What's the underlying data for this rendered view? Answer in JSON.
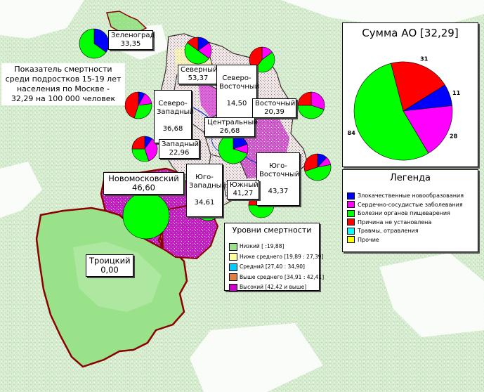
{
  "caption": [
    "Показатель смертности",
    "среди подростков 15-19 лет",
    "населения по Москве -",
    "32,29 на 100 000 человек"
  ],
  "colors": {
    "greenery": "#dcefd6",
    "forest": "#c3e0bb",
    "territory": "#99e28a",
    "high_level": "#cc00cc",
    "mid_high": "#e08040",
    "boundary": "#8b0000"
  },
  "summary": {
    "title": "Сумма АО [32,29]",
    "slices": [
      {
        "label": "11",
        "value": 11,
        "color": "#0000ff"
      },
      {
        "label": "28",
        "value": 28,
        "color": "#ff00ff"
      },
      {
        "label": "84",
        "value": 84,
        "color": "#00ff00"
      },
      {
        "label": "31",
        "value": 31,
        "color": "#ff0000"
      }
    ]
  },
  "legend": {
    "title": "Легенда",
    "items": [
      {
        "label": "Злокачественные новообразования",
        "color": "#0000ff"
      },
      {
        "label": "Сердечно-сосудистые заболевания",
        "color": "#ff00ff"
      },
      {
        "label": "Болезни органов пищеварения",
        "color": "#00ff00"
      },
      {
        "label": "Причина не установлена",
        "color": "#ff0000"
      },
      {
        "label": "Травмы, отравления",
        "color": "#00ffff"
      },
      {
        "label": "Прочие",
        "color": "#ffff00"
      }
    ]
  },
  "levels": {
    "title": "Уровни смертности",
    "items": [
      {
        "label": "Низкий  [      :19,88]",
        "color": "#99e28a"
      },
      {
        "label": "Ниже среднего  [19,89 : 27,39]",
        "color": "#ffff99"
      },
      {
        "label": "Средний  [27,40 : 34,90]",
        "color": "#00ccff"
      },
      {
        "label": "Выше среднего  [34,91 : 42,41]",
        "color": "#e08040"
      },
      {
        "label": "Высокий  [42,42 и выше]",
        "color": "#cc00cc"
      }
    ]
  },
  "districts": [
    {
      "id": "zelenograd",
      "name": "Зеленоград",
      "value": "33,35",
      "pie": [
        {
          "v": 35,
          "c": "#0000ff"
        },
        {
          "v": 65,
          "c": "#00ff00"
        }
      ]
    },
    {
      "id": "severny",
      "name": "Северный",
      "value": "53,37",
      "pie": [
        {
          "v": 15,
          "c": "#0000ff"
        },
        {
          "v": 20,
          "c": "#ff00ff"
        },
        {
          "v": 50,
          "c": "#00ff00"
        },
        {
          "v": 15,
          "c": "#ff0000"
        }
      ]
    },
    {
      "id": "severo-vostochny",
      "name": "Северо-\nВосточный",
      "value": "14,50",
      "pie": [
        {
          "v": 15,
          "c": "#ff00ff"
        },
        {
          "v": 45,
          "c": "#00ff00"
        },
        {
          "v": 40,
          "c": "#ff0000"
        }
      ]
    },
    {
      "id": "severo-zapadny",
      "name": "Северо-\nЗападный",
      "value": "36,68",
      "pie": [
        {
          "v": 8,
          "c": "#0000ff"
        },
        {
          "v": 15,
          "c": "#ff00ff"
        },
        {
          "v": 32,
          "c": "#00ff00"
        },
        {
          "v": 45,
          "c": "#ff0000"
        }
      ]
    },
    {
      "id": "vostochny",
      "name": "Восточный",
      "value": "20,39",
      "pie": [
        {
          "v": 30,
          "c": "#ff00ff"
        },
        {
          "v": 45,
          "c": "#00ff00"
        },
        {
          "v": 25,
          "c": "#ff0000"
        }
      ]
    },
    {
      "id": "tsentralny",
      "name": "Центральный",
      "value": "26,68",
      "pie": [
        {
          "v": 20,
          "c": "#0000ff"
        },
        {
          "v": 10,
          "c": "#ff00ff"
        },
        {
          "v": 70,
          "c": "#00ff00"
        }
      ]
    },
    {
      "id": "zapadny",
      "name": "Западный",
      "value": "22,96",
      "pie": [
        {
          "v": 10,
          "c": "#0000ff"
        },
        {
          "v": 35,
          "c": "#ff00ff"
        },
        {
          "v": 30,
          "c": "#00ff00"
        },
        {
          "v": 25,
          "c": "#ff0000"
        }
      ]
    },
    {
      "id": "yugo-vostochny",
      "name": "Юго-\nВосточный",
      "value": "43,37",
      "pie": [
        {
          "v": 12,
          "c": "#0000ff"
        },
        {
          "v": 10,
          "c": "#ff00ff"
        },
        {
          "v": 48,
          "c": "#00ff00"
        },
        {
          "v": 30,
          "c": "#ff0000"
        }
      ]
    },
    {
      "id": "novomoskovsky",
      "name": "Новомосковский",
      "value": "46,60",
      "pie": [
        {
          "v": 100,
          "c": "#00ff00"
        }
      ]
    },
    {
      "id": "yugo-zapadny",
      "name": "Юго-\nЗападный",
      "value": "34,61",
      "pie": [
        {
          "v": 10,
          "c": "#0000ff"
        },
        {
          "v": 12,
          "c": "#ff00ff"
        },
        {
          "v": 68,
          "c": "#00ff00"
        },
        {
          "v": 10,
          "c": "#ff0000"
        }
      ]
    },
    {
      "id": "yuzhny",
      "name": "Южный",
      "value": "41,27",
      "pie": [
        {
          "v": 15,
          "c": "#ff00ff"
        },
        {
          "v": 60,
          "c": "#00ff00"
        },
        {
          "v": 25,
          "c": "#ff0000"
        }
      ]
    },
    {
      "id": "troitsky",
      "name": "Троицкий",
      "value": "0,00"
    }
  ]
}
